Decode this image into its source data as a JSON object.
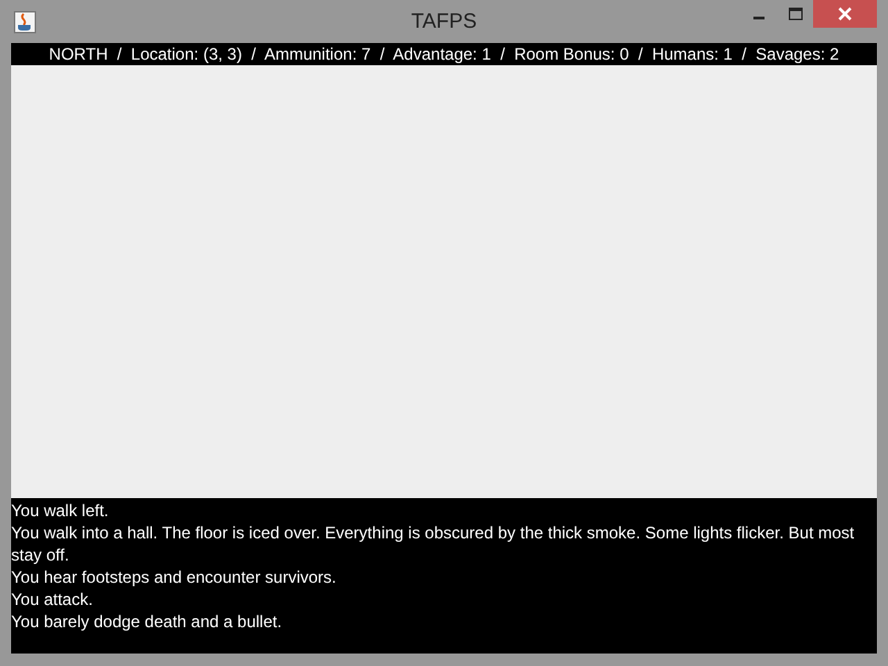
{
  "window": {
    "title": "TAFPS"
  },
  "status_bar": "NORTH  /  Location: (3, 3)  /  Ammunition: 7  /  Advantage: 1  /  Room Bonus: 0  /  Humans: 1  /  Savages: 2",
  "log": [
    "You walk left.",
    "You walk into a hall. The floor is iced over. Everything is obscured by the thick smoke. Some lights flicker. But most stay off.",
    "You hear footsteps and encounter survivors.",
    "You attack.",
    "You barely dodge death and a bullet."
  ]
}
